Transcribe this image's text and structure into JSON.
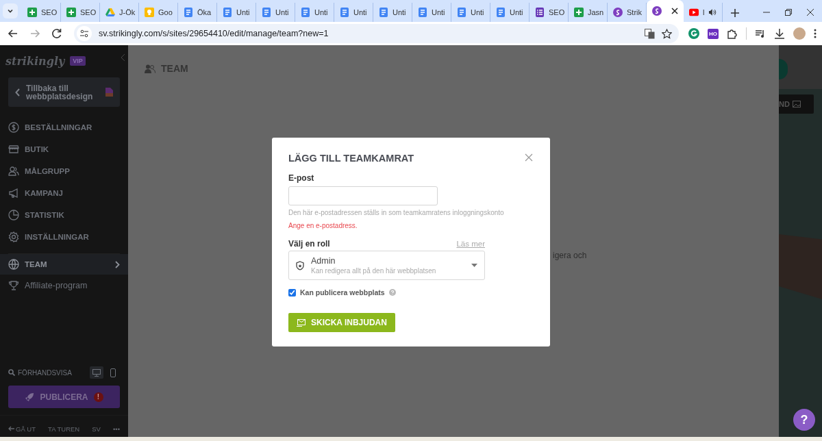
{
  "browser": {
    "tabs": [
      {
        "kind": "sheets",
        "title": "SEO",
        "selected": false,
        "audio": false
      },
      {
        "kind": "sheets",
        "title": "SEO",
        "selected": false,
        "audio": false
      },
      {
        "kind": "drive",
        "title": "J-Ök",
        "selected": false,
        "audio": false
      },
      {
        "kind": "keep",
        "title": "Goo",
        "selected": false,
        "audio": false
      },
      {
        "kind": "docs",
        "title": "Öka",
        "selected": false,
        "audio": false
      },
      {
        "kind": "docs",
        "title": "Unti",
        "selected": false,
        "audio": false
      },
      {
        "kind": "docs",
        "title": "Unti",
        "selected": false,
        "audio": false
      },
      {
        "kind": "docs",
        "title": "Unti",
        "selected": false,
        "audio": false
      },
      {
        "kind": "docs",
        "title": "Unti",
        "selected": false,
        "audio": false
      },
      {
        "kind": "docs",
        "title": "Unti",
        "selected": false,
        "audio": false
      },
      {
        "kind": "docs",
        "title": "Unti",
        "selected": false,
        "audio": false
      },
      {
        "kind": "docs",
        "title": "Unti",
        "selected": false,
        "audio": false
      },
      {
        "kind": "docs",
        "title": "Unti",
        "selected": false,
        "audio": false
      },
      {
        "kind": "forms",
        "title": "SEO",
        "selected": false,
        "audio": false
      },
      {
        "kind": "sheets",
        "title": "Jasn",
        "selected": false,
        "audio": false
      },
      {
        "kind": "strikingly",
        "title": "Strik",
        "selected": false,
        "audio": false
      },
      {
        "kind": "strikingly",
        "selected": true,
        "audio": false
      },
      {
        "kind": "youtube",
        "title": "l",
        "selected": false,
        "audio": true
      }
    ],
    "address": "sv.strikingly.com/s/sites/29654410/edit/manage/team?new=1",
    "extension_badge": "HO"
  },
  "sidebar": {
    "logo": "strikingly",
    "badge": "VIP",
    "back_button": "Tillbaka till webbplatsdesign",
    "items": [
      {
        "kind": "dollar",
        "label": "BESTÄLLNINGAR",
        "selected": false
      },
      {
        "kind": "store",
        "label": "BUTIK",
        "selected": false
      },
      {
        "kind": "people",
        "label": "MÅLGRUPP",
        "selected": false
      },
      {
        "kind": "megaphone",
        "label": "KAMPANJ",
        "selected": false
      },
      {
        "kind": "chart",
        "label": "STATISTIK",
        "selected": false
      },
      {
        "kind": "gear",
        "label": "INSTÄLLNINGAR",
        "selected": false
      },
      {
        "kind": "globe",
        "label": "TEAM",
        "selected": true
      },
      {
        "kind": "trophy",
        "label": "Affiliate-program",
        "selected": false
      }
    ],
    "preview": {
      "label": "FÖRHANDSVISA",
      "devices": [
        {
          "kind": "desktop",
          "selected": true
        },
        {
          "kind": "mobile",
          "selected": false
        }
      ]
    },
    "publish": {
      "label": "PUBLICERA",
      "alert": "!"
    },
    "footer": [
      "GÅ UT",
      "TA TUREN",
      "SV",
      "•••"
    ]
  },
  "main": {
    "title": "TEAM",
    "background_text": "igera och"
  },
  "right_panel": {
    "button": "ND"
  },
  "help_button": "?",
  "dialog": {
    "title": "LÄGG TILL TEAMKAMRAT",
    "email": {
      "label": "E-post",
      "hint": "Den här e-postadressen ställs in som teamkamratens inloggningskonto",
      "error": "Ange en e-postadress."
    },
    "role": {
      "label": "Välj en roll",
      "link": "Läs mer",
      "value": "Admin",
      "description": "Kan redigera allt på den här webbplatsen"
    },
    "publish_checkbox": {
      "label": "Kan publicera webbplats",
      "checked": true
    },
    "submit": "SKICKA INBJUDAN"
  }
}
